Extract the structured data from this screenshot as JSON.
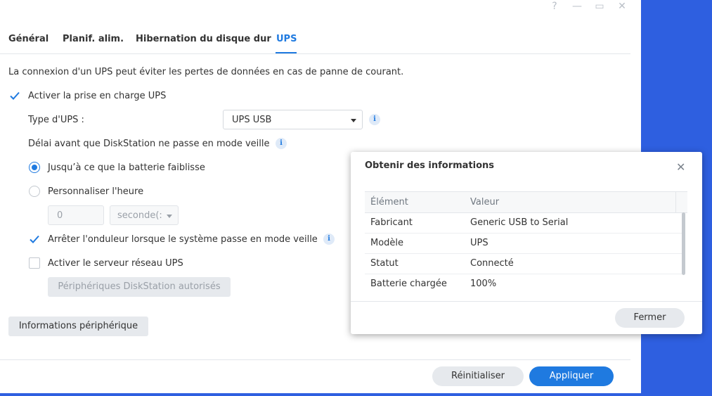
{
  "window": {
    "controls": {
      "help": "?",
      "minimize": "—",
      "maximize": "▭",
      "close": "✕"
    }
  },
  "tabs": [
    {
      "label": "Général"
    },
    {
      "label": "Planif. alim."
    },
    {
      "label": "Hibernation du disque dur"
    },
    {
      "label": "UPS"
    }
  ],
  "ups": {
    "description": "La connexion d'un UPS peut éviter les pertes de données en cas de panne de courant.",
    "enable_label": "Activer la prise en charge UPS",
    "type_label": "Type d'UPS :",
    "type_value": "UPS USB",
    "delay_label": "Délai avant que DiskStation ne passe en mode veille",
    "radio_battery_low": "Jusqu’à ce que la batterie faiblisse",
    "radio_custom_time": "Personnaliser l'heure",
    "custom_time_value": "0",
    "custom_time_unit": "seconde(:",
    "shutdown_ups_label": "Arrêter l'onduleur lorsque le système passe en mode veille",
    "network_server_label": "Activer le serveur réseau UPS",
    "authorized_devices_button": "Périphériques DiskStation autorisés",
    "device_info_button": "Informations périphérique"
  },
  "footer": {
    "reset": "Réinitialiser",
    "apply": "Appliquer"
  },
  "dialog": {
    "title": "Obtenir des informations",
    "close": "✕",
    "columns": [
      "Élément",
      "Valeur"
    ],
    "rows": [
      {
        "item": "Fabricant",
        "value": "Generic USB to Serial"
      },
      {
        "item": "Modèle",
        "value": "UPS"
      },
      {
        "item": "Statut",
        "value": "Connecté"
      },
      {
        "item": "Batterie chargée",
        "value": "100%"
      }
    ],
    "close_button": "Fermer"
  },
  "colors": {
    "accent": "#1f7ae0",
    "desktop": "#2e5fe0"
  }
}
